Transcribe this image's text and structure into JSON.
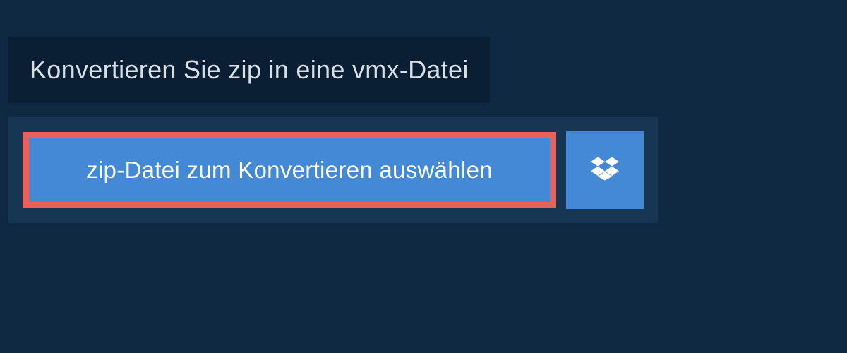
{
  "header": {
    "title": "Konvertieren Sie zip in eine vmx-Datei"
  },
  "actions": {
    "select_file_label": "zip-Datei zum Konvertieren auswählen",
    "dropbox_icon": "dropbox"
  }
}
